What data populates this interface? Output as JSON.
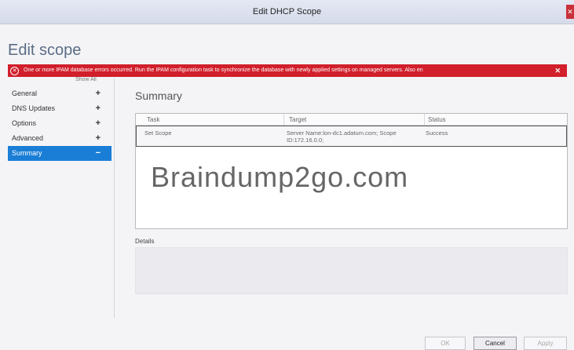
{
  "window": {
    "title": "Edit DHCP Scope"
  },
  "page": {
    "heading": "Edit scope"
  },
  "error": {
    "message": "One or more IPAM database errors occurred. Run the IPAM configuration task to synchronize the database with newly applied settings on managed servers. Also en",
    "close_glyph": "✕"
  },
  "sidebar": {
    "show_all": "Show All",
    "items": [
      {
        "label": "General",
        "sign": "+"
      },
      {
        "label": "DNS Updates",
        "sign": "+"
      },
      {
        "label": "Options",
        "sign": "+"
      },
      {
        "label": "Advanced",
        "sign": "+"
      },
      {
        "label": "Summary",
        "sign": "−"
      }
    ]
  },
  "summary": {
    "title": "Summary",
    "columns": [
      "Task",
      "Target",
      "Status"
    ],
    "rows": [
      {
        "task": "Set Scope",
        "target_line1": "Server Name:lon-dc1.adatum.com; Scope",
        "target_line2": "ID:172.16.0.0;",
        "status": "Success"
      }
    ],
    "watermark": "Braindump2go.com"
  },
  "details": {
    "label": "Details"
  },
  "buttons": {
    "ok": "OK",
    "cancel": "Cancel",
    "apply": "Apply"
  }
}
